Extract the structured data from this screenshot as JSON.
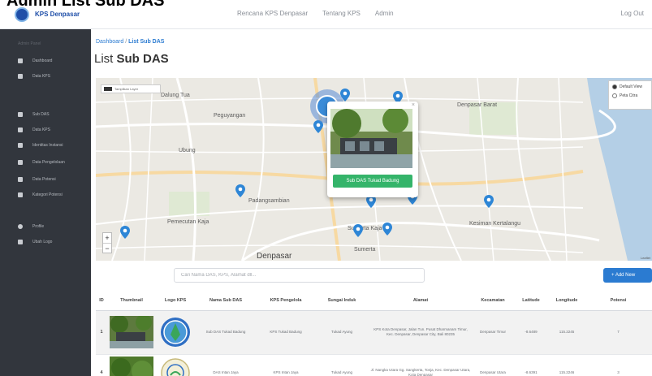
{
  "caption_overlay": "Admin List Sub DAS",
  "topbar": {
    "brand": "KPS Denpasar",
    "nav": [
      "Rencana KPS Denpasar",
      "Tentang KPS",
      "Admin"
    ],
    "logout": "Log Out"
  },
  "sidebar": {
    "user": "Admin Panel",
    "items": [
      {
        "label": "Dashboard"
      },
      {
        "label": "Data KPS"
      },
      {
        "label": "Sub DAS"
      },
      {
        "label": "Data KPS"
      },
      {
        "label": "Identitas Instansi"
      },
      {
        "label": "Data Pengelolaan"
      },
      {
        "label": "Data Potensi"
      },
      {
        "label": "Kategori Potensi"
      },
      {
        "label": "Profile"
      },
      {
        "label": "Ubah Logo"
      }
    ]
  },
  "breadcrumb": {
    "home": "Dashboard",
    "sep": "/",
    "current": "List Sub DAS"
  },
  "page_title": {
    "prefix": "List",
    "bold": "Sub DAS"
  },
  "map": {
    "layer_label": "Tampilkan Layer",
    "basemap_options": [
      {
        "label": "Default View",
        "selected": true
      },
      {
        "label": "Peta Citra",
        "selected": false
      }
    ],
    "zoom_in": "+",
    "zoom_out": "−",
    "labels": [
      "Dalung Tua",
      "Peguyangan",
      "Ubung",
      "Denpasar Barat",
      "Pemecutan Kaja",
      "Sumerta Kaja",
      "Sumerta",
      "Kesiman Kertalangu",
      "Denpasar",
      "Padangsambian"
    ],
    "popup_button": "Sub DAS Tukad Badung",
    "popup_close": "×",
    "attribution": "Leaflet"
  },
  "search": {
    "placeholder": "Cari Nama DAS, KPS, Alamat dll..."
  },
  "add_button": "+ Add New",
  "table": {
    "headers": [
      "ID",
      "Thumbnail",
      "Logo KPS",
      "Nama Sub DAS",
      "KPS Pengelola",
      "Sungai Induk",
      "Alamat",
      "Kecamatan",
      "Latitude",
      "Longitude",
      "Potensi"
    ],
    "rows": [
      {
        "id": "1",
        "nama": "Sub DAS Tukad Badung",
        "kps": "KPS Tukad Badung",
        "sungai": "Tukad Ayung",
        "alamat": "KPS Kota Denpasar, Jalan Tun. Pusat Dharmanam Timur, Kec. Denpasar, Denpasar City, Bali 80235",
        "kecamatan": "Denpasar Timur",
        "lat": "-8.6489",
        "lng": "115.2245",
        "potensi": "7"
      },
      {
        "id": "4",
        "nama": "DAS Intan Jaya",
        "kps": "KPS Intan Jaya",
        "sungai": "Tukad Ayung",
        "alamat": "Jl. Nangka Utara Gg. Sangkerta, Tonja, Kec. Denpasar Utara, Kota Denpasar",
        "kecamatan": "Denpasar Utara",
        "lat": "-8.6391",
        "lng": "115.2246",
        "potensi": "3"
      }
    ]
  },
  "colors": {
    "primary": "#2b7bd1",
    "sidebar": "#32363d",
    "success": "#34b46a",
    "pin": "#2e86d6"
  }
}
